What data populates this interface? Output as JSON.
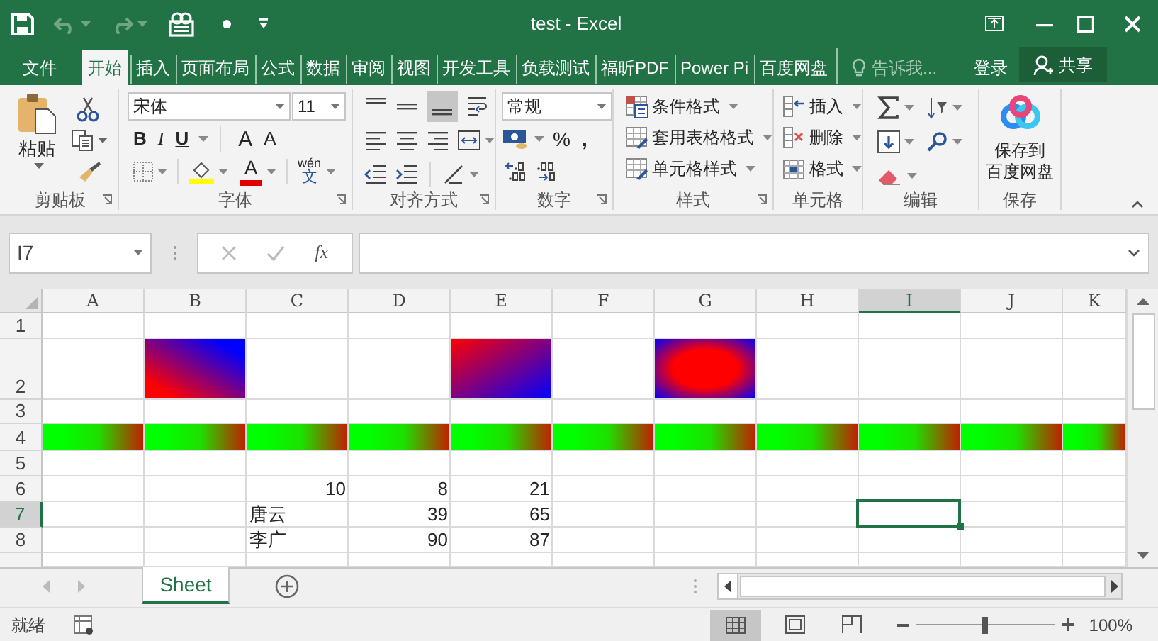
{
  "window": {
    "title": "test - Excel"
  },
  "tabs": [
    {
      "label": "文件",
      "selected": false
    },
    {
      "label": "开始",
      "selected": true
    },
    {
      "label": "插入",
      "selected": false
    },
    {
      "label": "页面布局",
      "selected": false
    },
    {
      "label": "公式",
      "selected": false
    },
    {
      "label": "数据",
      "selected": false
    },
    {
      "label": "审阅",
      "selected": false
    },
    {
      "label": "视图",
      "selected": false
    },
    {
      "label": "开发工具",
      "selected": false
    },
    {
      "label": "负载测试",
      "selected": false
    },
    {
      "label": "福昕PDF",
      "selected": false
    },
    {
      "label": "Power Pi",
      "selected": false
    },
    {
      "label": "百度网盘",
      "selected": false
    }
  ],
  "tell_me": {
    "placeholder": "告诉我..."
  },
  "account": {
    "sign_in": "登录",
    "share": "共享"
  },
  "ribbon": [
    {
      "label": "剪贴板",
      "controls": [
        {
          "text": "粘贴"
        }
      ]
    },
    {
      "label": "字体",
      "controls": [
        {
          "value": "宋体"
        },
        {
          "value": "11"
        },
        {
          "text": "B"
        },
        {
          "text": "I"
        },
        {
          "text": "U"
        },
        {
          "text": "A"
        },
        {
          "text": "A"
        },
        {
          "text": "A"
        },
        {
          "text": "wén"
        },
        {
          "text": "文"
        }
      ]
    },
    {
      "label": "对齐方式"
    },
    {
      "label": "数字",
      "controls": [
        {
          "value": "常规"
        },
        {
          "text": "%"
        },
        {
          "text": ","
        }
      ]
    },
    {
      "label": "样式",
      "controls": [
        {
          "text": "条件格式"
        },
        {
          "text": "套用表格格式"
        },
        {
          "text": "单元格样式"
        }
      ]
    },
    {
      "label": "单元格",
      "controls": [
        {
          "text": "插入"
        },
        {
          "text": "删除"
        },
        {
          "text": "格式"
        }
      ]
    },
    {
      "label": "编辑"
    },
    {
      "label": "保存",
      "controls": [
        {
          "text": "保存到"
        },
        {
          "text": "百度网盘"
        }
      ]
    }
  ],
  "name_box": {
    "value": "I7"
  },
  "formula_bar": {
    "fx": "fx"
  },
  "columns": [
    {
      "label": "A",
      "selected": false
    },
    {
      "label": "B",
      "selected": false
    },
    {
      "label": "C",
      "selected": false
    },
    {
      "label": "D",
      "selected": false
    },
    {
      "label": "E",
      "selected": false
    },
    {
      "label": "F",
      "selected": false
    },
    {
      "label": "G",
      "selected": false
    },
    {
      "label": "H",
      "selected": false
    },
    {
      "label": "I",
      "selected": true
    },
    {
      "label": "J",
      "selected": false
    },
    {
      "label": "K",
      "selected": false
    }
  ],
  "rows": [
    {
      "header": "1",
      "selected": false,
      "cells": [
        {
          "selected": false
        },
        {
          "selected": false
        },
        {
          "selected": false
        },
        {
          "selected": false
        },
        {
          "selected": false
        },
        {
          "selected": false
        },
        {
          "selected": false
        },
        {
          "selected": false
        },
        {
          "selected": false
        },
        {
          "selected": false
        },
        {
          "selected": false
        }
      ]
    },
    {
      "header": "2",
      "selected": false,
      "cells": [
        {
          "selected": false
        },
        {
          "kind": "gradient_up",
          "selected": false
        },
        {
          "selected": false
        },
        {
          "selected": false
        },
        {
          "kind": "gradient_down",
          "selected": false
        },
        {
          "selected": false
        },
        {
          "kind": "gradient_center",
          "selected": false
        },
        {
          "selected": false
        },
        {
          "selected": false
        },
        {
          "selected": false
        },
        {
          "selected": false
        }
      ]
    },
    {
      "header": "3",
      "selected": false,
      "cells": [
        {
          "selected": false
        },
        {
          "selected": false
        },
        {
          "selected": false
        },
        {
          "selected": false
        },
        {
          "selected": false
        },
        {
          "selected": false
        },
        {
          "selected": false
        },
        {
          "selected": false
        },
        {
          "selected": false
        },
        {
          "selected": false
        },
        {
          "selected": false
        }
      ]
    },
    {
      "header": "4",
      "selected": false,
      "cells": [
        {
          "kind": "gradient_horizontal",
          "selected": false
        },
        {
          "kind": "gradient_horizontal",
          "selected": false
        },
        {
          "kind": "gradient_horizontal",
          "selected": false
        },
        {
          "kind": "gradient_horizontal",
          "selected": false
        },
        {
          "kind": "gradient_horizontal",
          "selected": false
        },
        {
          "kind": "gradient_horizontal",
          "selected": false
        },
        {
          "kind": "gradient_horizontal",
          "selected": false
        },
        {
          "kind": "gradient_horizontal",
          "selected": false
        },
        {
          "kind": "gradient_horizontal",
          "selected": false
        },
        {
          "kind": "gradient_horizontal",
          "selected": false
        },
        {
          "kind": "gradient_horizontal",
          "selected": false
        }
      ]
    },
    {
      "header": "5",
      "selected": false,
      "cells": [
        {
          "selected": false
        },
        {
          "selected": false
        },
        {
          "selected": false
        },
        {
          "selected": false
        },
        {
          "selected": false
        },
        {
          "selected": false
        },
        {
          "selected": false
        },
        {
          "selected": false
        },
        {
          "selected": false
        },
        {
          "selected": false
        },
        {
          "selected": false
        }
      ]
    },
    {
      "header": "6",
      "selected": false,
      "cells": [
        {
          "selected": false
        },
        {
          "selected": false
        },
        {
          "text": "10",
          "kind": "number",
          "selected": false
        },
        {
          "text": "8",
          "kind": "number",
          "selected": false
        },
        {
          "text": "21",
          "kind": "number",
          "selected": false
        },
        {
          "selected": false
        },
        {
          "selected": false
        },
        {
          "selected": false
        },
        {
          "selected": false
        },
        {
          "selected": false
        },
        {
          "selected": false
        }
      ]
    },
    {
      "header": "7",
      "selected": true,
      "cells": [
        {
          "selected": false
        },
        {
          "selected": false
        },
        {
          "text": "唐云",
          "kind": "text",
          "selected": false
        },
        {
          "text": "39",
          "kind": "number",
          "selected": false
        },
        {
          "text": "65",
          "kind": "number",
          "selected": false
        },
        {
          "selected": false
        },
        {
          "selected": false
        },
        {
          "selected": false
        },
        {
          "selected": true
        },
        {
          "selected": false
        },
        {
          "selected": false
        }
      ]
    },
    {
      "header": "8",
      "selected": false,
      "cells": [
        {
          "selected": false
        },
        {
          "selected": false
        },
        {
          "text": "李广",
          "kind": "text",
          "selected": false
        },
        {
          "text": "90",
          "kind": "number",
          "selected": false
        },
        {
          "text": "87",
          "kind": "number",
          "selected": false
        },
        {
          "selected": false
        },
        {
          "selected": false
        },
        {
          "selected": false
        },
        {
          "selected": false
        },
        {
          "selected": false
        },
        {
          "selected": false
        }
      ]
    }
  ],
  "sheets": [
    {
      "label": "Sheet",
      "selected": true
    }
  ],
  "status": {
    "text": "就绪"
  },
  "zoom": {
    "level": 0.5,
    "reading": "100%"
  }
}
